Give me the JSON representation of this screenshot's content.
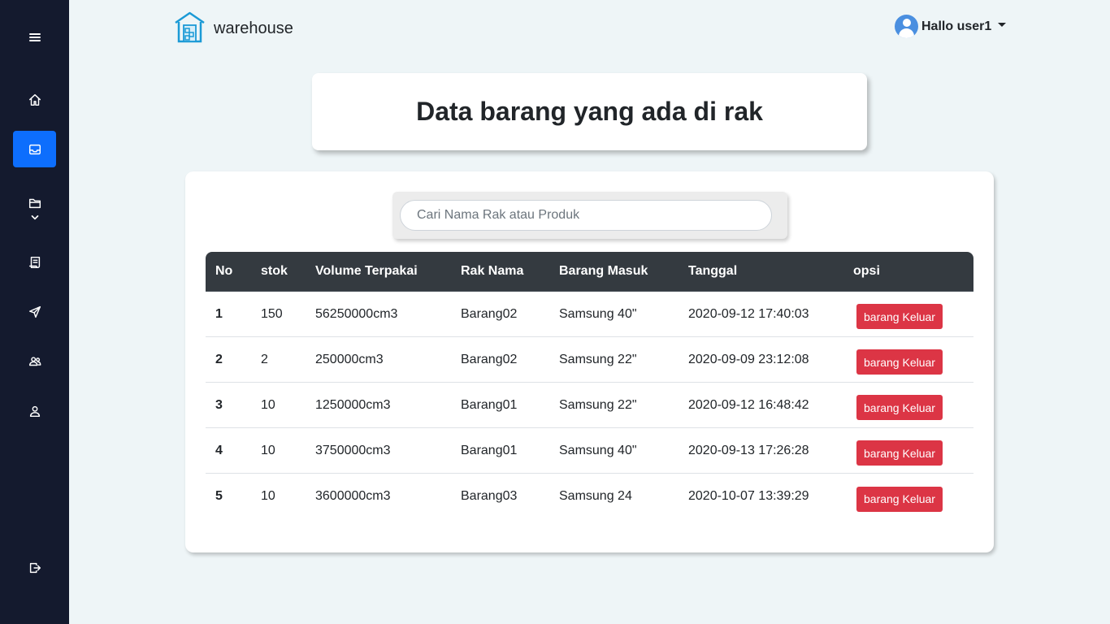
{
  "sidebar": {
    "items": [
      {
        "icon": "menu-icon"
      },
      {
        "icon": "home-icon"
      },
      {
        "icon": "inbox-icon",
        "active": true
      },
      {
        "icon": "folder-icon"
      },
      {
        "icon": "receipt-icon"
      },
      {
        "icon": "send-icon"
      },
      {
        "icon": "people-icon"
      },
      {
        "icon": "person-icon"
      },
      {
        "icon": "logout-icon"
      }
    ]
  },
  "brand": {
    "name": "warehouse",
    "icon": "warehouse-icon"
  },
  "user": {
    "greeting": "Hallo user1"
  },
  "page": {
    "title": "Data barang yang ada di rak"
  },
  "search": {
    "placeholder": "Cari Nama Rak atau Produk",
    "value": ""
  },
  "table": {
    "headers": [
      "No",
      "stok",
      "Volume Terpakai",
      "Rak Nama",
      "Barang Masuk",
      "Tanggal",
      "opsi"
    ],
    "rows": [
      {
        "no": "1",
        "stok": "150",
        "volume": "56250000cm3",
        "rak": "Barang02",
        "barang": "Samsung 40\"",
        "tanggal": "2020-09-12 17:40:03",
        "action": "barang Keluar"
      },
      {
        "no": "2",
        "stok": "2",
        "volume": "250000cm3",
        "rak": "Barang02",
        "barang": "Samsung 22\"",
        "tanggal": "2020-09-09 23:12:08",
        "action": "barang Keluar"
      },
      {
        "no": "3",
        "stok": "10",
        "volume": "1250000cm3",
        "rak": "Barang01",
        "barang": "Samsung 22\"",
        "tanggal": "2020-09-12 16:48:42",
        "action": "barang Keluar"
      },
      {
        "no": "4",
        "stok": "10",
        "volume": "3750000cm3",
        "rak": "Barang01",
        "barang": "Samsung 40\"",
        "tanggal": "2020-09-13 17:26:28",
        "action": "barang Keluar"
      },
      {
        "no": "5",
        "stok": "10",
        "volume": "3600000cm3",
        "rak": "Barang03",
        "barang": "Samsung 24",
        "tanggal": "2020-10-07 13:39:29",
        "action": "barang Keluar"
      }
    ]
  },
  "colors": {
    "sidebar": "#141a2e",
    "accent": "#0d6efd",
    "danger": "#dc3545",
    "table_header": "#343a40",
    "background": "#eef5f7"
  }
}
